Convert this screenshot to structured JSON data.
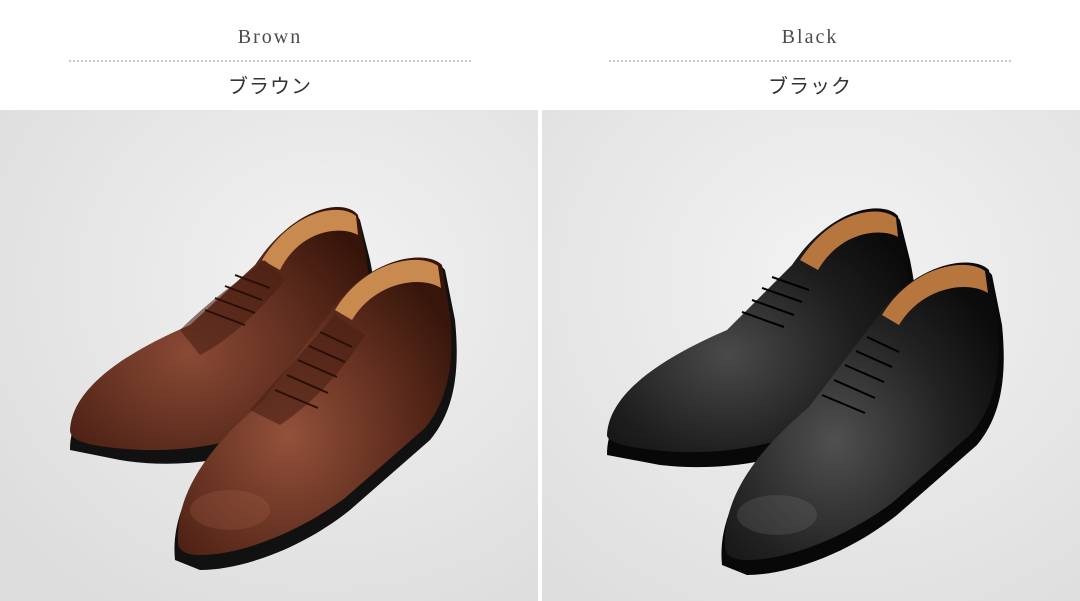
{
  "colors": [
    {
      "name_en": "Brown",
      "name_jp": "ブラウン",
      "leather": "#5a2a1c",
      "leather_dark": "#3a180f",
      "leather_light": "#7d4330"
    },
    {
      "name_en": "Black",
      "name_jp": "ブラック",
      "leather": "#1e1e1e",
      "leather_dark": "#0c0c0c",
      "leather_light": "#3a3a3a"
    }
  ],
  "backdrop_color": "#e6e6e6",
  "lining_color": "#c98a4f",
  "sole_color": "#111111"
}
